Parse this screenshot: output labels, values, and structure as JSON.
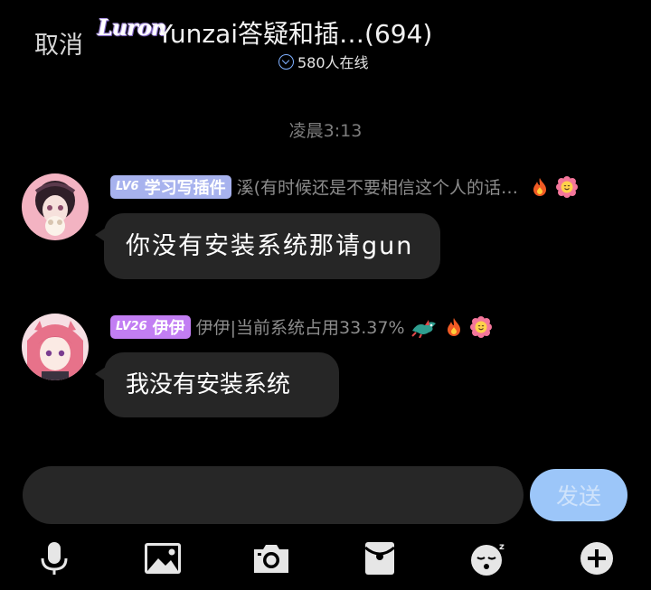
{
  "header": {
    "cancel_label": "取消",
    "logo_text": "Luron",
    "title": "Yunzai答疑和插…(694)",
    "online_count": "580人在线"
  },
  "timestamp": "凌晨3:13",
  "messages": [
    {
      "level": "LV6",
      "badge": "学习写插件",
      "badge_color": "#a7b2ee",
      "sender": "溪(有时候还是不要相信这个人的话…",
      "text": "你没有安装系统那请gun",
      "avatar_colors": [
        "#f6b9c6",
        "#3a2630"
      ],
      "icons": [
        "fire-icon",
        "flower-face-icon"
      ]
    },
    {
      "level": "LV26",
      "badge": "伊伊",
      "badge_color": "#c27ef3",
      "sender": "伊伊|当前系统占用33.37%",
      "text": "我没有安装系统",
      "avatar_colors": [
        "#f4c8d4",
        "#e4788e"
      ],
      "icons": [
        "dragon-icon",
        "fire-icon",
        "flower-face-icon"
      ]
    }
  ],
  "input": {
    "value": "",
    "placeholder": ""
  },
  "send_label": "发送",
  "toolbar": [
    "mic-icon",
    "image-icon",
    "camera-icon",
    "red-packet-icon",
    "sticker-face-icon",
    "plus-icon"
  ],
  "colors": {
    "send_button": "#9cc6f9",
    "online_accent": "#7fb0ff",
    "bubble": "#262626"
  }
}
